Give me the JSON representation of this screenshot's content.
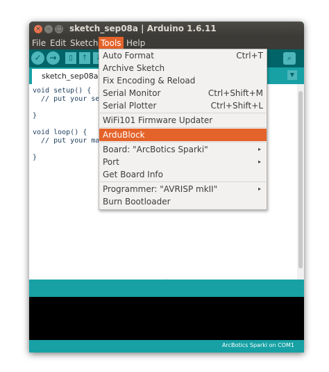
{
  "window": {
    "title": "sketch_sep08a | Arduino 1.6.11",
    "colors": {
      "teal": "#17a1a5",
      "dark_teal": "#006468",
      "accent": "#e4632a"
    }
  },
  "menubar": {
    "items": [
      {
        "label": "File",
        "icon": ""
      },
      {
        "label": "Edit"
      },
      {
        "label": "Sketch"
      },
      {
        "label": "Tools"
      },
      {
        "label": "Help"
      }
    ]
  },
  "toolbar": {
    "icons": [
      "verify-icon",
      "upload-icon",
      "new-icon",
      "open-icon",
      "save-icon",
      "serial-monitor-icon"
    ]
  },
  "tabs": [
    {
      "label": "sketch_sep08a"
    }
  ],
  "editor": {
    "lines": [
      "void setup() {",
      "  // put your set",
      "",
      "}",
      "",
      "void loop() {",
      "  // put your mai",
      "",
      "}"
    ]
  },
  "tools_menu": {
    "items": [
      {
        "label": "Auto Format",
        "shortcut": "Ctrl+T"
      },
      {
        "label": "Archive Sketch",
        "shortcut": ""
      },
      {
        "label": "Fix Encoding & Reload",
        "shortcut": ""
      },
      {
        "label": "Serial Monitor",
        "shortcut": "Ctrl+Shift+M"
      },
      {
        "label": "Serial Plotter",
        "shortcut": "Ctrl+Shift+L"
      },
      {
        "label": "WiFi101 Firmware Updater",
        "shortcut": ""
      },
      {
        "label": "ArduBlock",
        "shortcut": ""
      },
      {
        "label": "Board: \"ArcBotics Sparki\"",
        "submenu": true
      },
      {
        "label": "Port",
        "submenu": true
      },
      {
        "label": "Get Board Info",
        "shortcut": ""
      },
      {
        "label": "Programmer: \"AVRISP mkII\"",
        "submenu": true
      },
      {
        "label": "Burn Bootloader",
        "shortcut": ""
      }
    ]
  },
  "status": {
    "text": "ArcBotics Sparki on COM1"
  }
}
